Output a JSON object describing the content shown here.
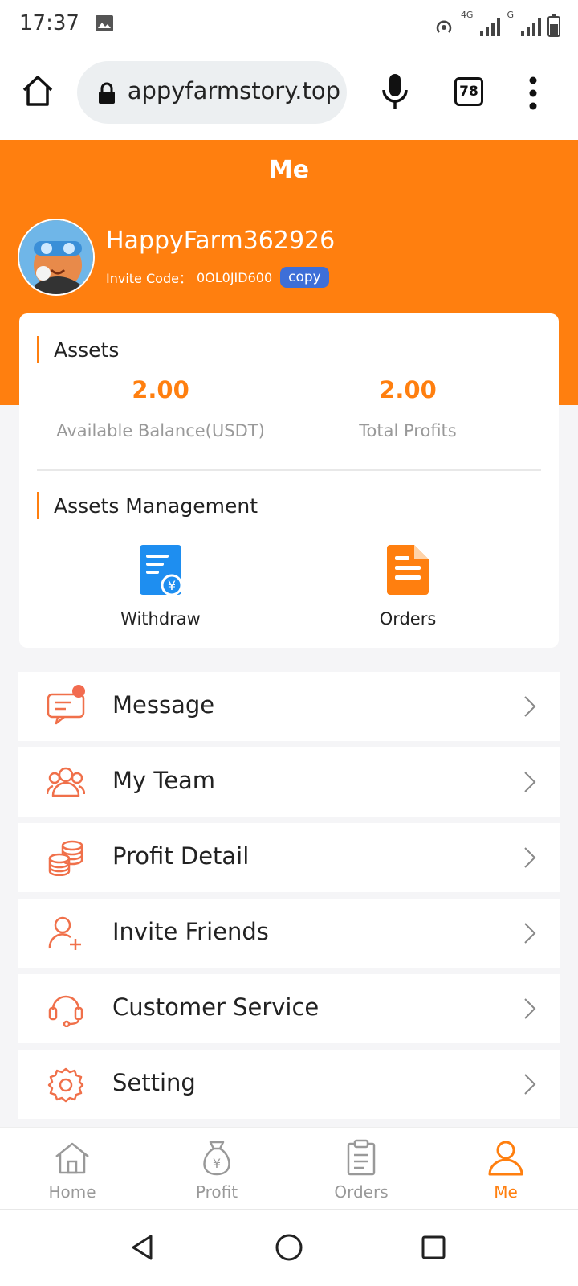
{
  "status_bar": {
    "time": "17:37",
    "net_4g": "4G",
    "net_g": "G"
  },
  "browser": {
    "url": "appyfarmstory.top",
    "tab_count": "78"
  },
  "header": {
    "title": "Me",
    "username": "HappyFarm362926",
    "invite_label": "Invite Code：",
    "invite_code": "0OL0JID600",
    "copy_label": "copy"
  },
  "assets": {
    "title": "Assets",
    "available_balance": "2.00",
    "available_balance_label": "Available Balance(USDT)",
    "total_profits": "2.00",
    "total_profits_label": "Total Profits"
  },
  "assets_management": {
    "title": "Assets Management",
    "actions": [
      {
        "label": "Withdraw",
        "icon": "withdraw-icon"
      },
      {
        "label": "Orders",
        "icon": "orders-icon"
      }
    ]
  },
  "menu": [
    {
      "label": "Message",
      "icon": "message-icon",
      "has_badge": true
    },
    {
      "label": "My Team",
      "icon": "team-icon"
    },
    {
      "label": "Profit Detail",
      "icon": "coins-icon"
    },
    {
      "label": "Invite Friends",
      "icon": "add-user-icon"
    },
    {
      "label": "Customer Service",
      "icon": "headset-icon"
    },
    {
      "label": "Setting",
      "icon": "gear-icon"
    }
  ],
  "bottom_nav": [
    {
      "label": "Home",
      "icon": "home-icon"
    },
    {
      "label": "Profit",
      "icon": "money-bag-icon"
    },
    {
      "label": "Orders",
      "icon": "clipboard-icon"
    },
    {
      "label": "Me",
      "icon": "user-icon",
      "active": true
    }
  ],
  "colors": {
    "accent": "#ff7f0f",
    "copy_button": "#3e6fd8",
    "menu_icon": "#f0704a",
    "withdraw_icon": "#1e8ef0"
  }
}
